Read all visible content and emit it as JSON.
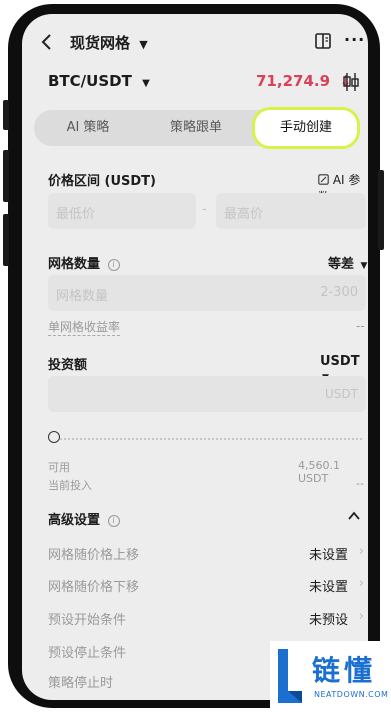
{
  "header": {
    "title": "现货网格"
  },
  "pair": {
    "symbol": "BTC/USDT",
    "price": "71,274.9",
    "price_direction": "↓",
    "price_color": "#d9415a"
  },
  "tabs": [
    {
      "label": "AI 策略",
      "active": false
    },
    {
      "label": "策略跟单",
      "active": false
    },
    {
      "label": "手动创建",
      "active": true
    }
  ],
  "price_range": {
    "label": "价格区间 (USDT)",
    "ai_params": "AI 参数",
    "min_placeholder": "最低价",
    "separator": "-",
    "max_placeholder": "最高价"
  },
  "grid_count": {
    "label": "网格数量",
    "mode": "等差",
    "placeholder": "网格数量",
    "range_hint": "2-300",
    "yield_label": "单网格收益率",
    "yield_value": "--"
  },
  "investment": {
    "label": "投资额",
    "currency": "USDT",
    "unit": "USDT",
    "available_label": "可用",
    "available_value": "4,560.1 USDT",
    "current_label": "当前投入",
    "current_value": "--"
  },
  "advanced": {
    "label": "高级设置",
    "rows": [
      {
        "label": "网格随价格上移",
        "value": "未设置"
      },
      {
        "label": "网格随价格下移",
        "value": "未设置"
      },
      {
        "label": "预设开始条件",
        "value": "未预设"
      },
      {
        "label": "预设停止条件",
        "value": ""
      },
      {
        "label": "策略停止时",
        "value": ""
      }
    ]
  },
  "watermark": {
    "brand": "链懂",
    "site": "NEATDOWN.COM",
    "brand_color": "#1a6fd1"
  }
}
